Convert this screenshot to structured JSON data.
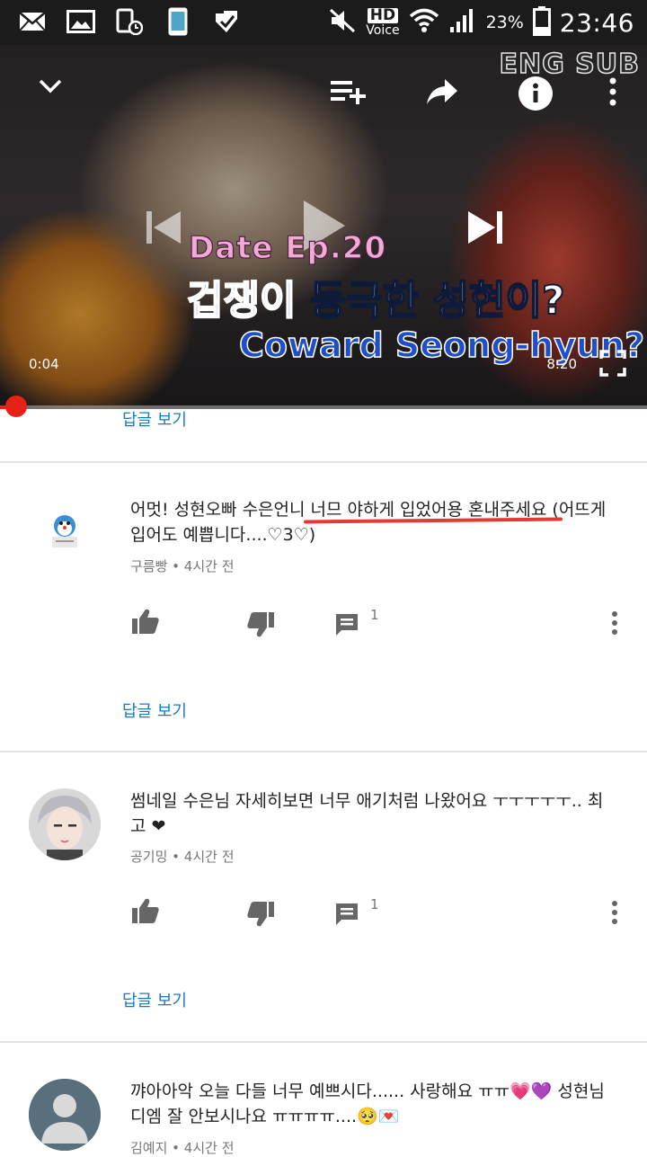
{
  "status_bar": {
    "hd_label": "HD",
    "voice_label": "Voice",
    "battery_percent": "23%",
    "time": "23:46"
  },
  "player": {
    "overlay_tag": "ENG SUB",
    "episode_title": "Date Ep.20",
    "title_kr_highlight": "겁쟁이",
    "title_kr_rest": " 등극한 성현이?",
    "title_en": "Coward Seong-hyun?",
    "current_time": "0:04",
    "duration": "8:20",
    "progress_fraction": 0.008,
    "icons": [
      "chevron-down-icon",
      "add-to-playlist-icon",
      "share-icon",
      "info-icon",
      "more-vert-icon",
      "previous-icon",
      "play-icon",
      "next-icon",
      "fullscreen-icon"
    ]
  },
  "view_replies_label": "답글 보기",
  "comments": [
    {
      "text": "어멋! 성현오빠 수은언니 너므 야하게 입었어용 혼내주세요 (어뜨게 입어도 예쁩니다....♡3♡)",
      "author": "구름빵",
      "time": "4시간 전",
      "reply_count": "1"
    },
    {
      "text": "썸네일 수은님 자세히보면 너무 애기처럼 나왔어요 ㅜㅜㅜㅜㅜ.. 최고 ❤",
      "author": "공기밍",
      "time": "4시간 전",
      "reply_count": "1"
    },
    {
      "text": "꺄아아악 오늘 다들 너무 예쁘시다...... 사랑해요 ㅠㅠ💗💜 성현님 디엠 잘 안보시나요 ㅠㅠㅠㅠ....🥺💌",
      "author": "김예지",
      "time": "4시간 전"
    }
  ],
  "colors": {
    "accent_red": "#e62117",
    "link_blue": "#167ac6",
    "status_bar": "#1b1b1b"
  }
}
